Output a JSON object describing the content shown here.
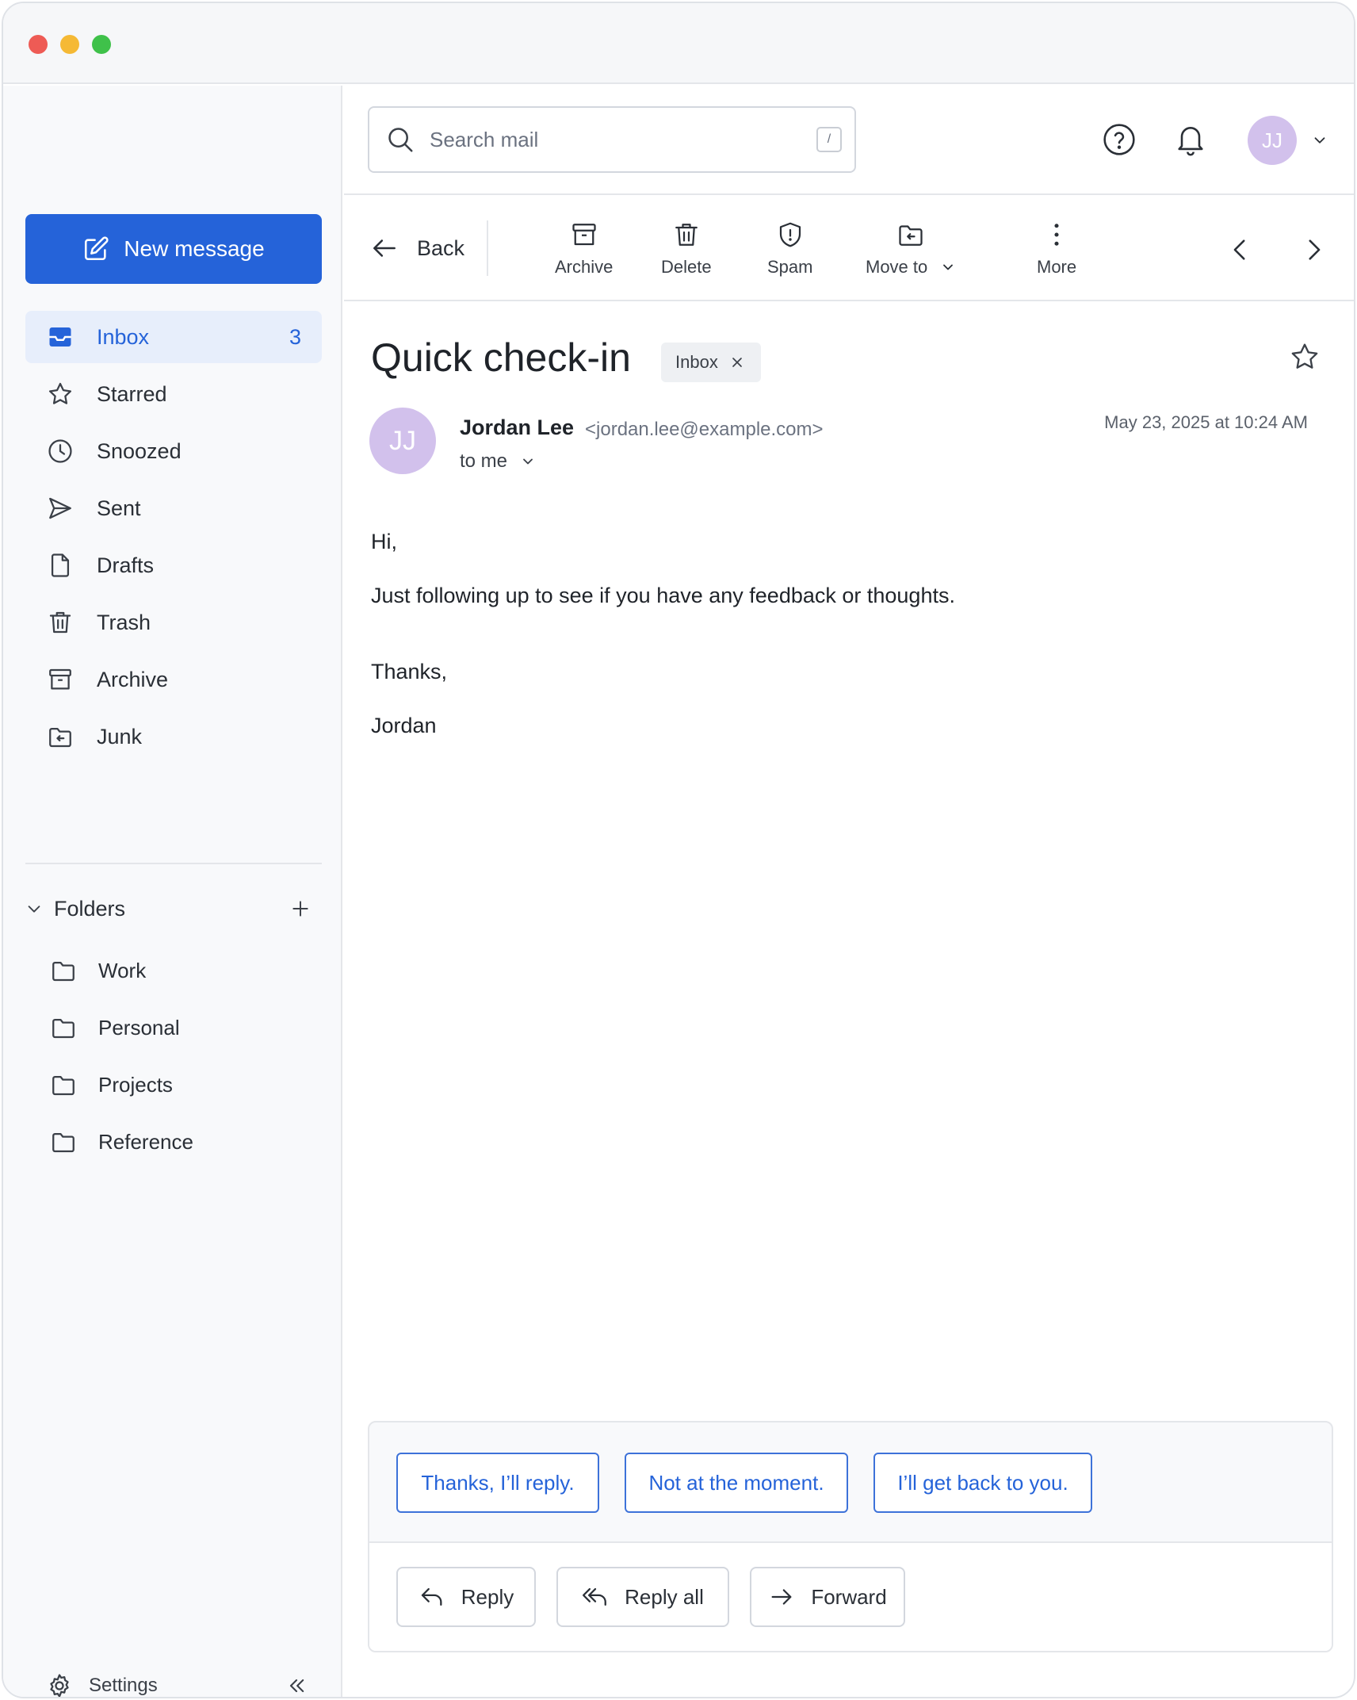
{
  "window": {
    "controls": [
      "close",
      "minimize",
      "zoom"
    ]
  },
  "sidebar": {
    "compose_label": "New message",
    "nav": [
      {
        "label": "Inbox",
        "icon": "inbox-icon",
        "count": "3",
        "active": true
      },
      {
        "label": "Starred",
        "icon": "star-icon"
      },
      {
        "label": "Snoozed",
        "icon": "clock-icon"
      },
      {
        "label": "Sent",
        "icon": "send-icon"
      },
      {
        "label": "Drafts",
        "icon": "file-icon"
      },
      {
        "label": "Trash",
        "icon": "trash-icon"
      },
      {
        "label": "Archive",
        "icon": "archive-icon"
      },
      {
        "label": "Junk",
        "icon": "junk-folder-icon"
      }
    ],
    "folders_label": "Folders",
    "folders": [
      "Work",
      "Personal",
      "Projects",
      "Reference"
    ],
    "settings_label": "Settings"
  },
  "search": {
    "placeholder": "Search mail",
    "shortcut": "/"
  },
  "user": {
    "initials": "JJ",
    "avatar_color": "#d2c1ec"
  },
  "toolbar": {
    "back_label": "Back",
    "archive_label": "Archive",
    "delete_label": "Delete",
    "spam_label": "Spam",
    "move_label": "Move to",
    "more_label": "More"
  },
  "message": {
    "subject": "Quick check-in",
    "label": "Inbox",
    "sender_initials": "JJ",
    "sender_name": "Jordan Lee",
    "sender_email": "<jordan.lee@example.com>",
    "recipient": "to me",
    "date": "May 23, 2025 at 10:24 AM",
    "body": {
      "greeting": "Hi,",
      "line1": "Just following up to see if you have any feedback or thoughts.",
      "closing": "Thanks,",
      "signature": "Jordan"
    }
  },
  "smart_replies": [
    "Thanks, I’ll reply.",
    "Not at the moment.",
    "I’ll get back to you."
  ],
  "actions": {
    "reply": "Reply",
    "reply_all": "Reply all",
    "forward": "Forward"
  },
  "colors": {
    "accent": "#2563d9",
    "active_bg": "#e7eefb",
    "border": "#e4e6ea"
  }
}
